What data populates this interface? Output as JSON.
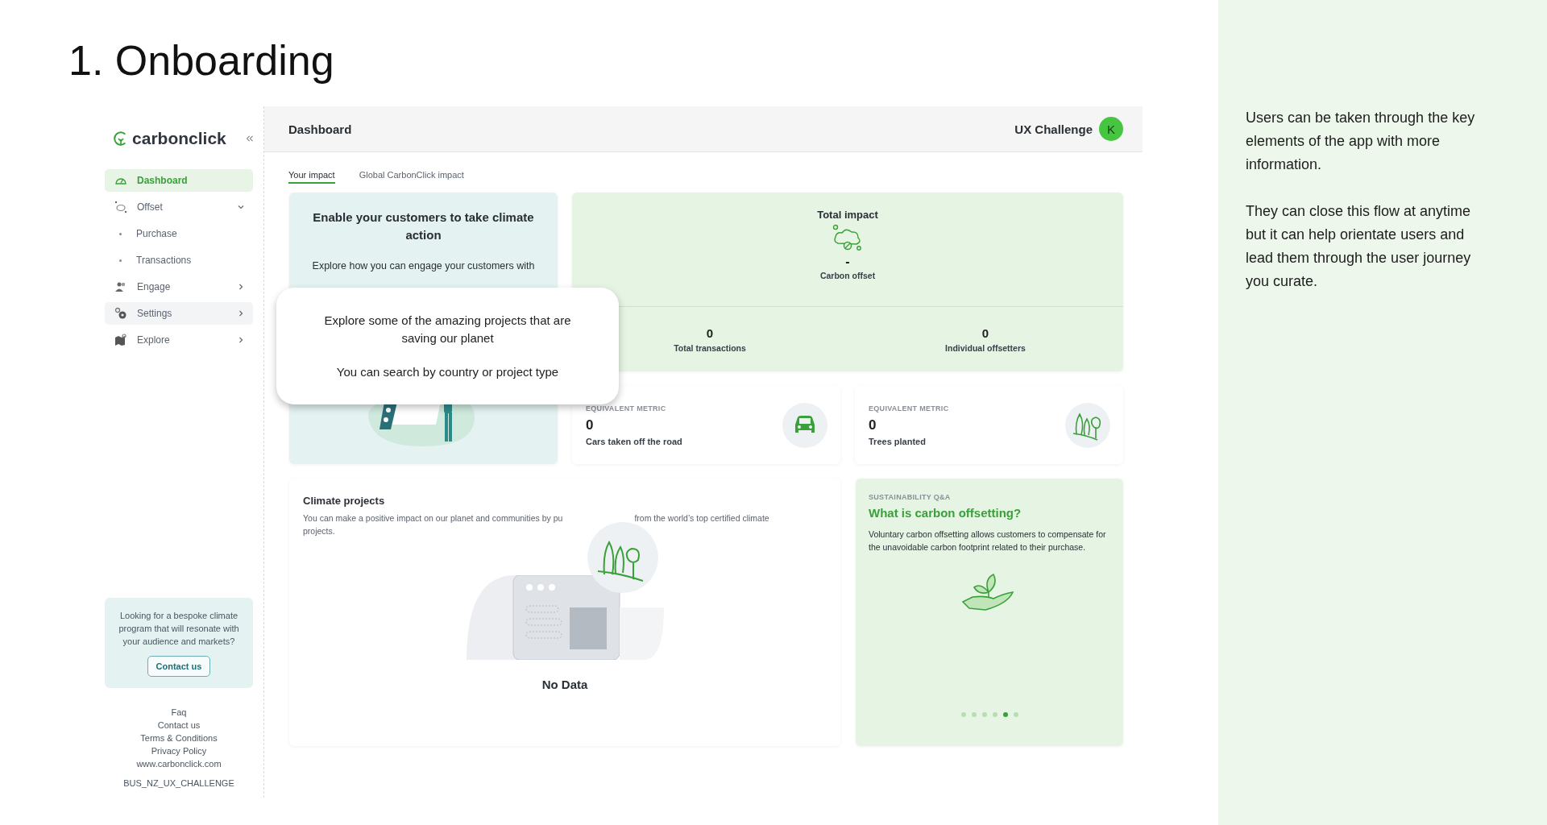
{
  "page_title": "1. Onboarding",
  "sidebar": {
    "logo": "carbonclick",
    "nav": [
      {
        "label": "Dashboard",
        "kind": "link",
        "selected": true,
        "hovered": false
      },
      {
        "label": "Offset",
        "kind": "group",
        "selected": false,
        "hovered": false,
        "expanded": true,
        "children": [
          {
            "label": "Purchase"
          },
          {
            "label": "Transactions"
          }
        ]
      },
      {
        "label": "Engage",
        "kind": "group",
        "selected": false,
        "hovered": false,
        "expanded": false
      },
      {
        "label": "Settings",
        "kind": "group",
        "selected": false,
        "hovered": true,
        "expanded": false
      },
      {
        "label": "Explore",
        "kind": "group",
        "selected": false,
        "hovered": false,
        "expanded": false
      }
    ],
    "promo": {
      "text": "Looking for a bespoke climate program that will resonate with your audience and markets?",
      "button": "Contact us"
    },
    "footer_links": [
      "Faq",
      "Contact us",
      "Terms & Conditions",
      "Privacy Policy",
      "www.carbonclick.com"
    ],
    "account_code": "BUS_NZ_UX_CHALLENGE"
  },
  "header": {
    "title": "Dashboard",
    "user": "UX Challenge",
    "avatar": "K"
  },
  "tabs": [
    {
      "label": "Your impact",
      "selected": true
    },
    {
      "label": "Global CarbonClick impact",
      "selected": false
    }
  ],
  "intro_card": {
    "title": "Enable your customers to take climate action",
    "text": "Explore how you can engage your customers with"
  },
  "tooltip": {
    "lines": [
      "Explore some of the amazing projects that are saving our planet",
      "You can search by country or project type"
    ]
  },
  "total_impact": {
    "title": "Total impact",
    "value": "-",
    "label": "Carbon offset",
    "stats": [
      {
        "value": "0",
        "label": "Total transactions"
      },
      {
        "value": "0",
        "label": "Individual offsetters"
      }
    ]
  },
  "metrics": [
    {
      "eyebrow": "EQUIVALENT METRIC",
      "value": "0",
      "label": "Cars taken off the road",
      "kind": "car"
    },
    {
      "eyebrow": "EQUIVALENT METRIC",
      "value": "0",
      "label": "Trees planted",
      "kind": "trees"
    }
  ],
  "climate_projects": {
    "title": "Climate projects",
    "text_start": "You can make a positive impact on our planet and communities by pu",
    "text_end": "from the world’s top certified climate",
    "text_wrap": "projects.",
    "empty": "No Data"
  },
  "qa": {
    "eyebrow": "SUSTAINABILITY Q&A",
    "title": "What is carbon offsetting?",
    "text": "Voluntary carbon offsetting allows customers to compensate for the unavoidable carbon footprint related to their purchase.",
    "dots": [
      {
        "selected": false
      },
      {
        "selected": false
      },
      {
        "selected": false
      },
      {
        "selected": false
      },
      {
        "selected": true
      },
      {
        "selected": false
      }
    ]
  },
  "notes": [
    "Users can be taken through the key elements of the app with more information.",
    "They can close this flow at anytime but it can help orientate users and lead them through the user journey you curate."
  ]
}
